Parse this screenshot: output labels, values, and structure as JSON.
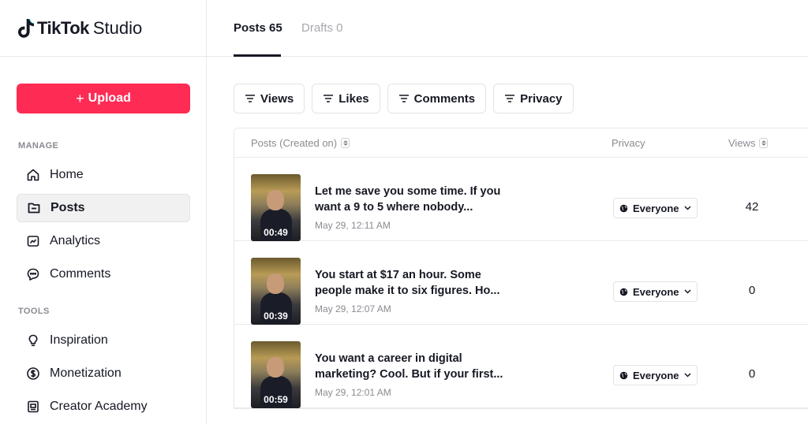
{
  "app": {
    "logo_text": "TikTok",
    "logo_suffix": "Studio"
  },
  "sidebar": {
    "upload_label": "Upload",
    "manage_label": "MANAGE",
    "tools_label": "TOOLS",
    "manage_items": [
      {
        "label": "Home",
        "icon": "home-icon"
      },
      {
        "label": "Posts",
        "icon": "posts-icon",
        "active": true
      },
      {
        "label": "Analytics",
        "icon": "analytics-icon"
      },
      {
        "label": "Comments",
        "icon": "comments-icon"
      }
    ],
    "tools_items": [
      {
        "label": "Inspiration",
        "icon": "lightbulb-icon"
      },
      {
        "label": "Monetization",
        "icon": "dollar-icon"
      },
      {
        "label": "Creator Academy",
        "icon": "academy-icon"
      }
    ]
  },
  "tabs": [
    {
      "label": "Posts 65",
      "active": true
    },
    {
      "label": "Drafts 0",
      "active": false
    }
  ],
  "filters": [
    "Views",
    "Likes",
    "Comments",
    "Privacy"
  ],
  "table": {
    "columns": [
      "Posts (Created on)",
      "Privacy",
      "Views"
    ],
    "rows": [
      {
        "title": "Let me save you some time. If you want a 9 to 5 where nobody...",
        "date": "May 29, 12:11 AM",
        "duration": "00:49",
        "privacy": "Everyone",
        "views": "42"
      },
      {
        "title": "You start at $17 an hour. Some people make it to six figures. Ho...",
        "date": "May 29, 12:07 AM",
        "duration": "00:39",
        "privacy": "Everyone",
        "views": "0"
      },
      {
        "title": "You want a career in digital marketing? Cool. But if your first...",
        "date": "May 29, 12:01 AM",
        "duration": "00:59",
        "privacy": "Everyone",
        "views": "0"
      }
    ]
  },
  "colors": {
    "accent": "#fe2c55",
    "text": "#161823",
    "muted": "#8a8b91"
  }
}
